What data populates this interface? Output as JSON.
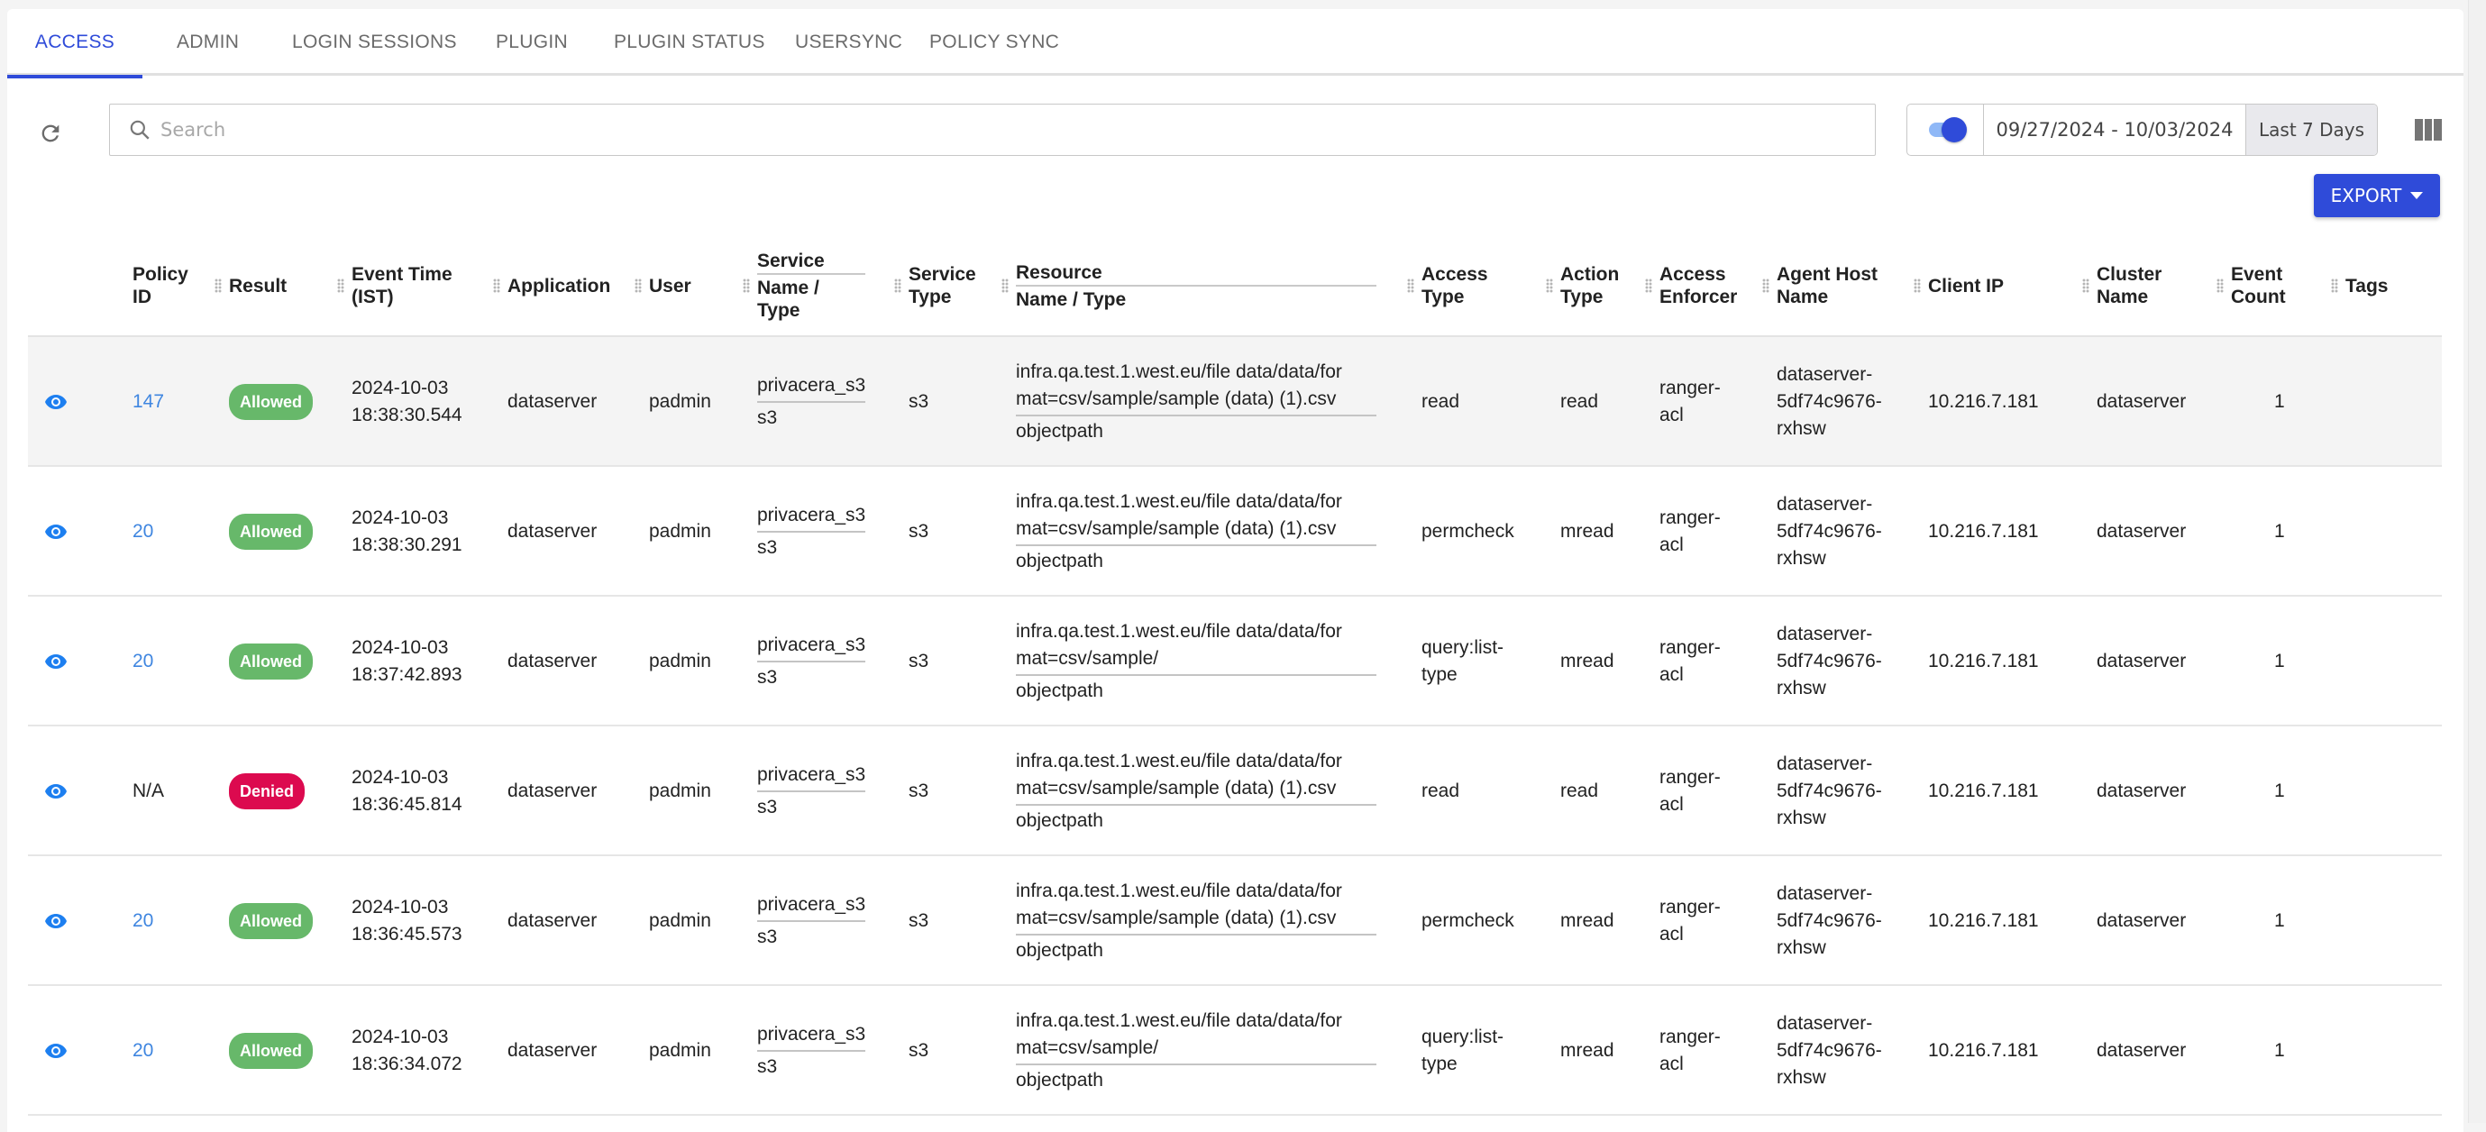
{
  "tabs": [
    {
      "label": "ACCESS",
      "active": true
    },
    {
      "label": "ADMIN",
      "active": false
    },
    {
      "label": "LOGIN SESSIONS",
      "active": false
    },
    {
      "label": "PLUGIN",
      "active": false
    },
    {
      "label": "PLUGIN STATUS",
      "active": false
    },
    {
      "label": "USERSYNC",
      "active": false
    },
    {
      "label": "POLICY SYNC",
      "active": false
    }
  ],
  "toolbar": {
    "search_placeholder": "Search",
    "search_value": "",
    "toggle_on": true,
    "date_range": "09/27/2024 - 10/03/2024",
    "date_preset": "Last 7 Days",
    "export_label": "EXPORT"
  },
  "colors": {
    "accent": "#2f4bd9",
    "link": "#3f86e0",
    "allowed": "#67b86a",
    "denied": "#dc0a4f"
  },
  "table": {
    "headers": {
      "policy_id": [
        "Policy",
        "ID"
      ],
      "result": "Result",
      "event_time": [
        "Event Time",
        "(IST)"
      ],
      "application": "Application",
      "user": "User",
      "service_name_type": {
        "top": "Service",
        "bottom": [
          "Name /",
          "Type"
        ]
      },
      "service_type": [
        "Service",
        "Type"
      ],
      "resource_name_type": {
        "top": "Resource",
        "bottom": "Name / Type"
      },
      "access_type": [
        "Access",
        "Type"
      ],
      "action_type": [
        "Action",
        "Type"
      ],
      "access_enforcer": [
        "Access",
        "Enforcer"
      ],
      "agent_host_name": [
        "Agent Host",
        "Name"
      ],
      "client_ip": "Client IP",
      "cluster_name": [
        "Cluster",
        "Name"
      ],
      "event_count": [
        "Event",
        "Count"
      ],
      "tags": "Tags"
    },
    "rows": [
      {
        "policy_id": "147",
        "policy_link": true,
        "result": "Allowed",
        "date": "2024-10-03",
        "time": "18:38:30.544",
        "application": "dataserver",
        "user": "padmin",
        "service_name": "privacera_s3",
        "service_name_type": "s3",
        "service_type": "s3",
        "resource_line1": "infra.qa.test.1.west.eu/file data/data/for",
        "resource_line2": "mat=csv/sample/sample (data) (1).csv",
        "resource_type": "objectpath",
        "access_type": [
          "read"
        ],
        "action_type": "read",
        "access_enforcer": [
          "ranger-",
          "acl"
        ],
        "agent_host": [
          "dataserver-",
          "5df74c9676-",
          "rxhsw"
        ],
        "client_ip": "10.216.7.181",
        "cluster_name": "dataserver",
        "event_count": "1",
        "tags": ""
      },
      {
        "policy_id": "20",
        "policy_link": true,
        "result": "Allowed",
        "date": "2024-10-03",
        "time": "18:38:30.291",
        "application": "dataserver",
        "user": "padmin",
        "service_name": "privacera_s3",
        "service_name_type": "s3",
        "service_type": "s3",
        "resource_line1": "infra.qa.test.1.west.eu/file data/data/for",
        "resource_line2": "mat=csv/sample/sample (data) (1).csv",
        "resource_type": "objectpath",
        "access_type": [
          "permcheck"
        ],
        "action_type": "mread",
        "access_enforcer": [
          "ranger-",
          "acl"
        ],
        "agent_host": [
          "dataserver-",
          "5df74c9676-",
          "rxhsw"
        ],
        "client_ip": "10.216.7.181",
        "cluster_name": "dataserver",
        "event_count": "1",
        "tags": ""
      },
      {
        "policy_id": "20",
        "policy_link": true,
        "result": "Allowed",
        "date": "2024-10-03",
        "time": "18:37:42.893",
        "application": "dataserver",
        "user": "padmin",
        "service_name": "privacera_s3",
        "service_name_type": "s3",
        "service_type": "s3",
        "resource_line1": "infra.qa.test.1.west.eu/file data/data/for",
        "resource_line2": "mat=csv/sample/",
        "resource_type": "objectpath",
        "access_type": [
          "query:list-",
          "type"
        ],
        "action_type": "mread",
        "access_enforcer": [
          "ranger-",
          "acl"
        ],
        "agent_host": [
          "dataserver-",
          "5df74c9676-",
          "rxhsw"
        ],
        "client_ip": "10.216.7.181",
        "cluster_name": "dataserver",
        "event_count": "1",
        "tags": ""
      },
      {
        "policy_id": "N/A",
        "policy_link": false,
        "result": "Denied",
        "date": "2024-10-03",
        "time": "18:36:45.814",
        "application": "dataserver",
        "user": "padmin",
        "service_name": "privacera_s3",
        "service_name_type": "s3",
        "service_type": "s3",
        "resource_line1": "infra.qa.test.1.west.eu/file data/data/for",
        "resource_line2": "mat=csv/sample/sample (data) (1).csv",
        "resource_type": "objectpath",
        "access_type": [
          "read"
        ],
        "action_type": "read",
        "access_enforcer": [
          "ranger-",
          "acl"
        ],
        "agent_host": [
          "dataserver-",
          "5df74c9676-",
          "rxhsw"
        ],
        "client_ip": "10.216.7.181",
        "cluster_name": "dataserver",
        "event_count": "1",
        "tags": ""
      },
      {
        "policy_id": "20",
        "policy_link": true,
        "result": "Allowed",
        "date": "2024-10-03",
        "time": "18:36:45.573",
        "application": "dataserver",
        "user": "padmin",
        "service_name": "privacera_s3",
        "service_name_type": "s3",
        "service_type": "s3",
        "resource_line1": "infra.qa.test.1.west.eu/file data/data/for",
        "resource_line2": "mat=csv/sample/sample (data) (1).csv",
        "resource_type": "objectpath",
        "access_type": [
          "permcheck"
        ],
        "action_type": "mread",
        "access_enforcer": [
          "ranger-",
          "acl"
        ],
        "agent_host": [
          "dataserver-",
          "5df74c9676-",
          "rxhsw"
        ],
        "client_ip": "10.216.7.181",
        "cluster_name": "dataserver",
        "event_count": "1",
        "tags": ""
      },
      {
        "policy_id": "20",
        "policy_link": true,
        "result": "Allowed",
        "date": "2024-10-03",
        "time": "18:36:34.072",
        "application": "dataserver",
        "user": "padmin",
        "service_name": "privacera_s3",
        "service_name_type": "s3",
        "service_type": "s3",
        "resource_line1": "infra.qa.test.1.west.eu/file data/data/for",
        "resource_line2": "mat=csv/sample/",
        "resource_type": "objectpath",
        "access_type": [
          "query:list-",
          "type"
        ],
        "action_type": "mread",
        "access_enforcer": [
          "ranger-",
          "acl"
        ],
        "agent_host": [
          "dataserver-",
          "5df74c9676-",
          "rxhsw"
        ],
        "client_ip": "10.216.7.181",
        "cluster_name": "dataserver",
        "event_count": "1",
        "tags": ""
      }
    ]
  }
}
